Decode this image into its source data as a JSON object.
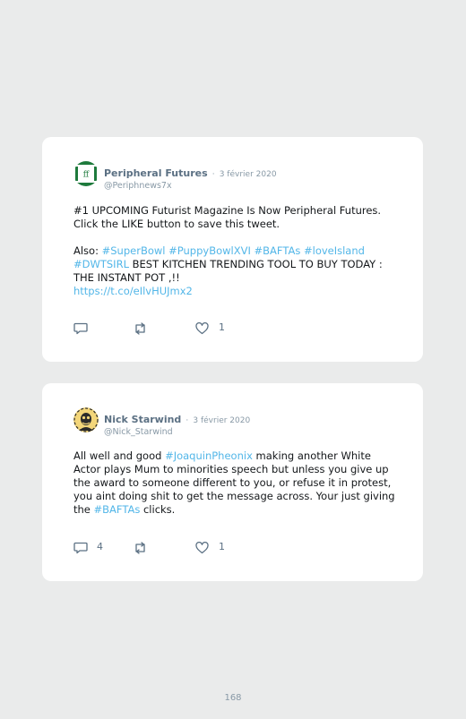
{
  "tweets": [
    {
      "author": "Peripheral Futures",
      "handle": "@Periphnews7x",
      "separator": "·",
      "date": "3 février 2020",
      "avatar_text": "ff",
      "avatar_colors": {
        "ring": "#1e7a3c",
        "bg": "#ffffff",
        "text": "#1e7a3c"
      },
      "body": {
        "p1": "#1 UPCOMING Futurist Magazine Is Now Peripheral Futures. Click the LIKE button to save this tweet.",
        "p2_intro": "Also: ",
        "tag1": "#SuperBowl",
        "tag2": "#PuppyBowlXVI",
        "tag3": "#BAFTAs",
        "tag4": "#loveIsland",
        "tag5": "#DWTSIRL",
        "p2_rest": " BEST KITCHEN TRENDING TOOL TO BUY TODAY : THE INSTANT POT ,!!",
        "link": "https://t.co/eIlvHUJmx2"
      },
      "reply_count": "",
      "retweet_count": "",
      "like_count": "1"
    },
    {
      "author": "Nick Starwind",
      "handle": "@Nick_Starwind",
      "separator": "·",
      "date": "3 février 2020",
      "avatar_colors": {
        "bg": "#f3d67a",
        "face": "#2b2b2b"
      },
      "body": {
        "t1": "All well and good ",
        "tag1": "#JoaquinPheonix",
        "t2": " making another White Actor plays Mum to minorities speech but unless you give up the award to someone different to you, or refuse it in protest, you aint doing shit to get the message across. Your just giving the ",
        "tag2": "#BAFTAs",
        "t3": " clicks."
      },
      "reply_count": "4",
      "retweet_count": "",
      "like_count": "1"
    }
  ],
  "page_number": "168",
  "colors": {
    "hashtag": "#52b6e8",
    "icon": "#5b7083",
    "background": "#eaebeb"
  }
}
